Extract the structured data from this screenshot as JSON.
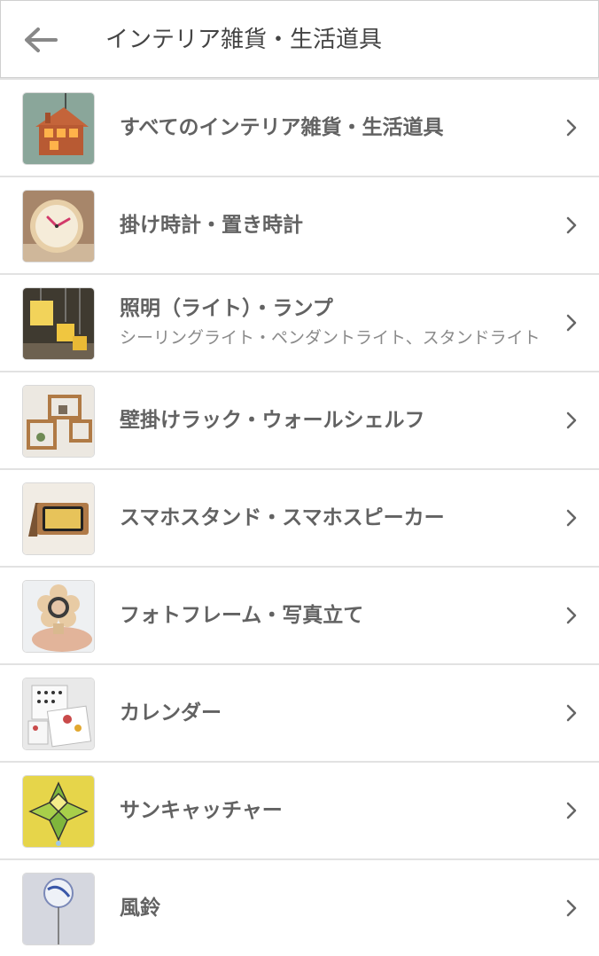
{
  "header": {
    "title": "インテリア雑貨・生活道具",
    "back_icon": "arrow-left-icon"
  },
  "items": [
    {
      "label": "すべてのインテリア雑貨・生活道具",
      "sub": "",
      "icon": "wooden-house-lamp"
    },
    {
      "label": "掛け時計・置き時計",
      "sub": "",
      "icon": "wooden-clock"
    },
    {
      "label": "照明（ライト）・ランプ",
      "sub": "シーリングライト・ペンダントライト、スタンドライト",
      "icon": "pendant-lights"
    },
    {
      "label": "壁掛けラック・ウォールシェルフ",
      "sub": "",
      "icon": "wall-shelves"
    },
    {
      "label": "スマホスタンド・スマホスピーカー",
      "sub": "",
      "icon": "phone-stand"
    },
    {
      "label": "フォトフレーム・写真立て",
      "sub": "",
      "icon": "flower-photo-frame"
    },
    {
      "label": "カレンダー",
      "sub": "",
      "icon": "calendar"
    },
    {
      "label": "サンキャッチャー",
      "sub": "",
      "icon": "stained-glass-suncatcher"
    },
    {
      "label": "風鈴",
      "sub": "",
      "icon": "wind-chime"
    }
  ],
  "colors": {
    "chevron": "#666666",
    "label": "#626262",
    "sub": "#8a8a8a",
    "divider": "#e2e2e2"
  }
}
